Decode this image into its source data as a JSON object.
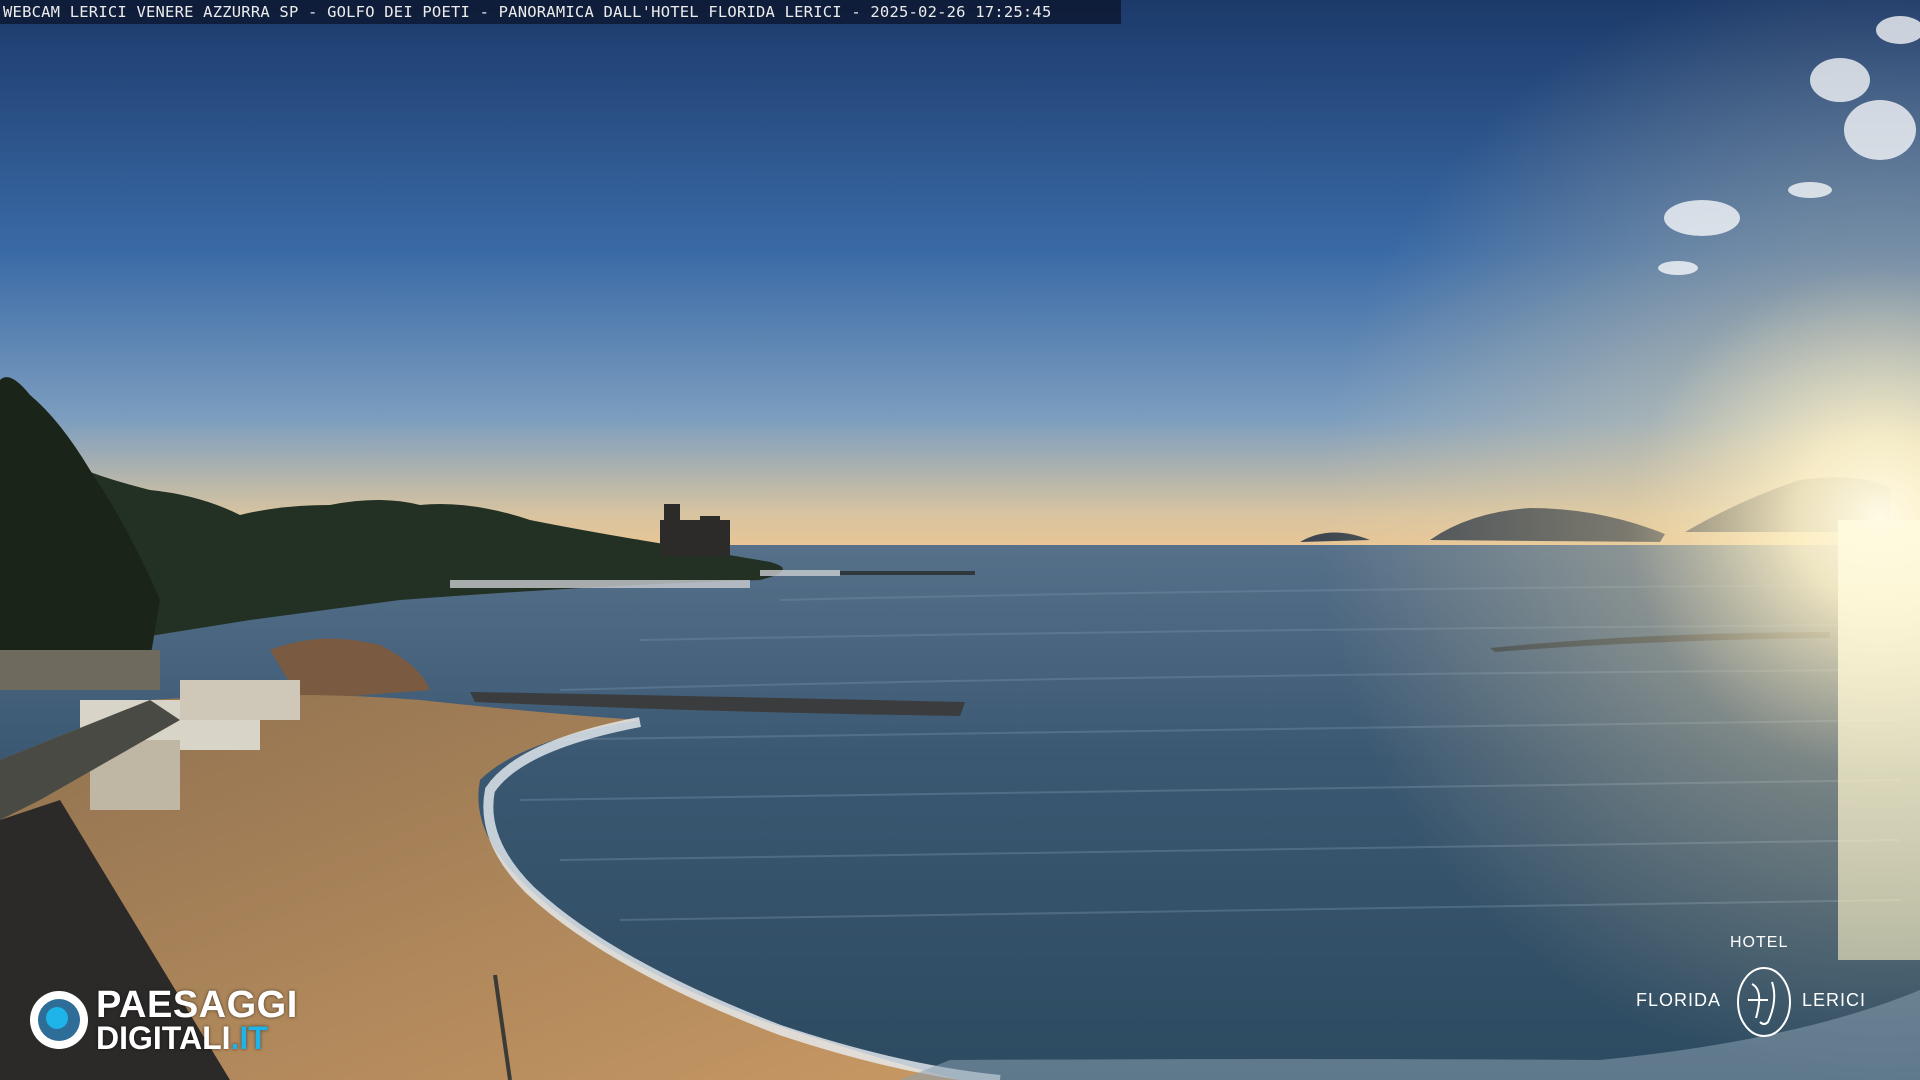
{
  "caption": {
    "text": "WEBCAM LERICI VENERE AZZURRA SP - GOLFO DEI POETI - PANORAMICA DALL'HOTEL FLORIDA LERICI - 2025-02-26 17:25:45"
  },
  "watermark_left": {
    "line1": "PAESAGGI",
    "line2_main": "DIGITALI",
    "line2_tld": ".IT"
  },
  "watermark_right": {
    "top": "HOTEL",
    "left": "FLORIDA",
    "right": "LERICI"
  },
  "colors": {
    "sky_top": "#1c3a6a",
    "sky_horizon": "#e8c79a",
    "sea": "#3d5a72",
    "sun": "#fff6d8",
    "sand": "#b08a5e",
    "brand_blue": "#1fb4e9"
  }
}
